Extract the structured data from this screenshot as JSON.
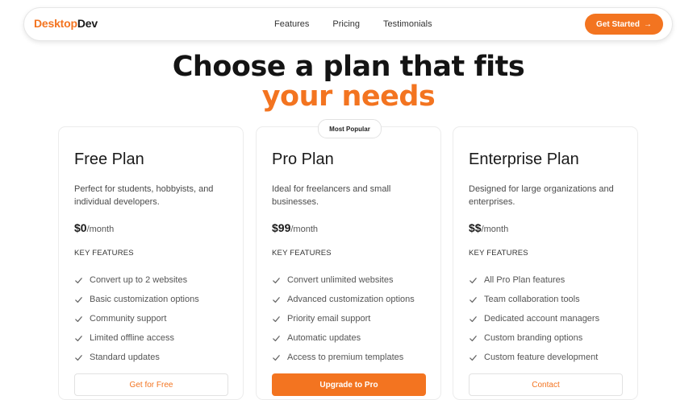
{
  "nav": {
    "logo_primary": "Desktop",
    "logo_secondary": "Dev",
    "links": [
      "Features",
      "Pricing",
      "Testimonials"
    ],
    "cta_label": "Get Started",
    "cta_arrow": "→"
  },
  "hero": {
    "line1": "Choose a plan that fits",
    "line2": "your needs"
  },
  "plans": [
    {
      "name": "Free Plan",
      "description": "Perfect for students, hobbyists, and individual developers.",
      "price": "$0",
      "period": "/month",
      "features_heading": "KEY FEATURES",
      "features": [
        "Convert up to 2 websites",
        "Basic customization options",
        "Community support",
        "Limited offline access",
        "Standard updates"
      ],
      "button_label": "Get for Free"
    },
    {
      "badge": "Most Popular",
      "name": "Pro Plan",
      "description": "Ideal for freelancers and small businesses.",
      "price": "$99",
      "period": "/month",
      "features_heading": "KEY FEATURES",
      "features": [
        "Convert unlimited websites",
        "Advanced customization options",
        "Priority email support",
        "Automatic updates",
        "Access to premium templates"
      ],
      "button_label": "Upgrade to Pro"
    },
    {
      "name": "Enterprise Plan",
      "description": "Designed for large organizations and enterprises.",
      "price": "$$",
      "period": "/month",
      "features_heading": "KEY FEATURES",
      "features": [
        "All Pro Plan features",
        "Team collaboration tools",
        "Dedicated account managers",
        "Custom branding options",
        "Custom feature development"
      ],
      "button_label": "Contact"
    }
  ],
  "colors": {
    "accent": "#f37420",
    "text": "#1a1a1a",
    "muted": "#555555"
  },
  "icons": {
    "check": "check-icon",
    "arrow": "arrow-right-icon"
  }
}
